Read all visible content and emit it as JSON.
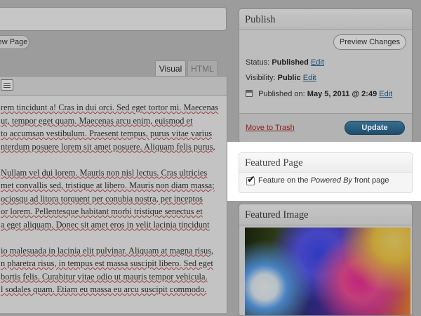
{
  "editor": {
    "view_page_label": "View Page",
    "tabs": {
      "visual": "Visual",
      "html": "HTML"
    },
    "paragraphs": [
      [
        "rem tincidunt a! Cras in dui orci. Sed eget tortor mi. Maecenas",
        "ut, tempor eget quam. Maecenas arcu enim, euismod et",
        "to accumsan vestibulum. Praesent tempus, purus vitae varius",
        "nterdum posuere lorem sit amet posuere. Aliquam felis purus,"
      ],
      [
        "Nullam vel dui lorem. Mauris non nisl lectus. Cras ultricies",
        "met convallis sed, tristique at libero. Mauris non diam massa;",
        "ociosqu ad litora torquent per conubia nostra, per inceptos",
        "or lorem. Pellentesque habitant morbi tristique senectus et",
        "a eget aliquam. Donec sit amet eros in velit lacinia tincidunt"
      ],
      [
        "io malesuada in lacinia elit pulvinar. Aliquam at magna risus,",
        "n pharetra risus, in tempus est massa suscipit libero. Sed eget",
        "bortis felis. Curabitur vitae odio ut mauris tempor vehicula.",
        "l sodales quam. Etiam eu massa eu arcu suscipit commodo."
      ]
    ]
  },
  "publish": {
    "title": "Publish",
    "preview_label": "Preview Changes",
    "status_label": "Status:",
    "status_value": "Published",
    "visibility_label": "Visibility:",
    "visibility_value": "Public",
    "published_on_label": "Published on:",
    "published_on_value": "May 5, 2011 @ 2:49",
    "edit_label": "Edit",
    "trash_label": "Move to Trash",
    "update_label": "Update"
  },
  "featured_page": {
    "title": "Featured Page",
    "checked": true,
    "label_prefix": "Feature on the ",
    "label_emphasis": "Powered By",
    "label_suffix": " front page"
  },
  "featured_image": {
    "title": "Featured Image"
  },
  "colors": {
    "overlay_gray": "#9c9c9c",
    "link": "#1c4d73",
    "trash": "#8a1f1f",
    "update_button": "#2a5a7a"
  },
  "icons": [
    "keyboard-icon",
    "calendar-icon",
    "checkmark-icon"
  ]
}
